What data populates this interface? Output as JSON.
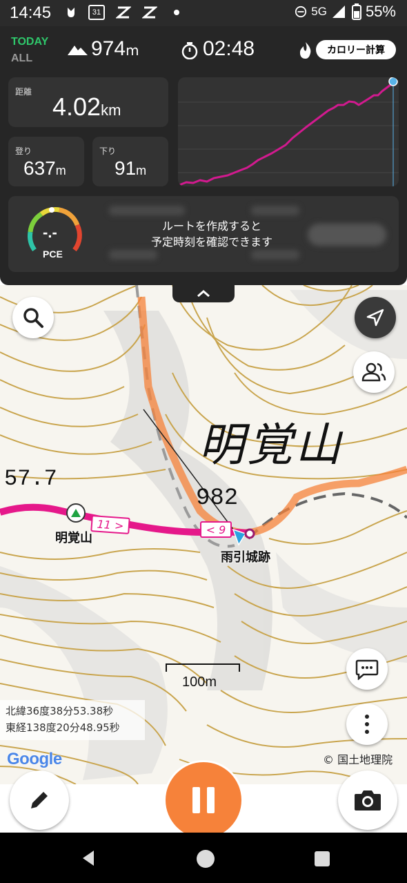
{
  "status": {
    "time": "14:45",
    "calendar_day": "31",
    "network": "5G",
    "battery": "55%"
  },
  "dashboard": {
    "today_label": "TODAY",
    "all_label": "ALL",
    "altitude_value": "974",
    "altitude_unit": "m",
    "elapsed": "02:48",
    "calorie_button": "カロリー計算",
    "distance_label": "距離",
    "distance_value": "4.02",
    "distance_unit": "km",
    "ascent_label": "登り",
    "ascent_value": "637",
    "ascent_unit": "m",
    "descent_label": "下り",
    "descent_value": "91",
    "descent_unit": "m",
    "pace_label": "PCE",
    "pace_value": "-.-",
    "route_notice_line1": "ルートを作成すると",
    "route_notice_line2": "予定時刻を確認できます"
  },
  "map": {
    "mountain_label_large": "明覚山",
    "elevation_label": "982",
    "elevation_label_2": "57.7",
    "summit_label": "明覚山",
    "castle_label": "雨引城跡",
    "segment_label_1": "11 >",
    "segment_label_2": "< 9",
    "scale_label": "100m",
    "latitude": "北緯36度38分53.38秒",
    "longitude": "東経138度20分48.95秒",
    "google_logo": "Google",
    "copyright": "© 国土地理院"
  },
  "colors": {
    "track": "#e5188a",
    "accent": "#f6823a",
    "today_green": "#2fc76b",
    "contour": "#c9a54e"
  }
}
